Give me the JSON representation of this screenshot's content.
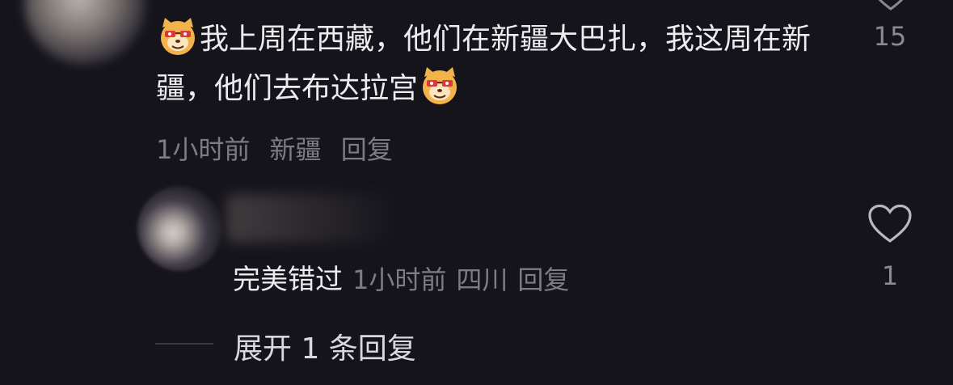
{
  "comment": {
    "text_part1": "我上周在西藏，他们在新疆大巴扎，我这周在新疆，他们去布达拉宫",
    "emoji_icon": "dog-emoji-icon",
    "time": "1小时前",
    "location": "新疆",
    "reply_label": "回复",
    "like_count": "15"
  },
  "reply": {
    "text": "完美错过",
    "time": "1小时前",
    "location": "四川",
    "reply_label": "回复",
    "like_count": "1"
  },
  "expand": {
    "label": "展开 1 条回复"
  },
  "colors": {
    "background": "#15141b",
    "primary_text": "#ececf0",
    "secondary_text": "#7d7c85"
  }
}
